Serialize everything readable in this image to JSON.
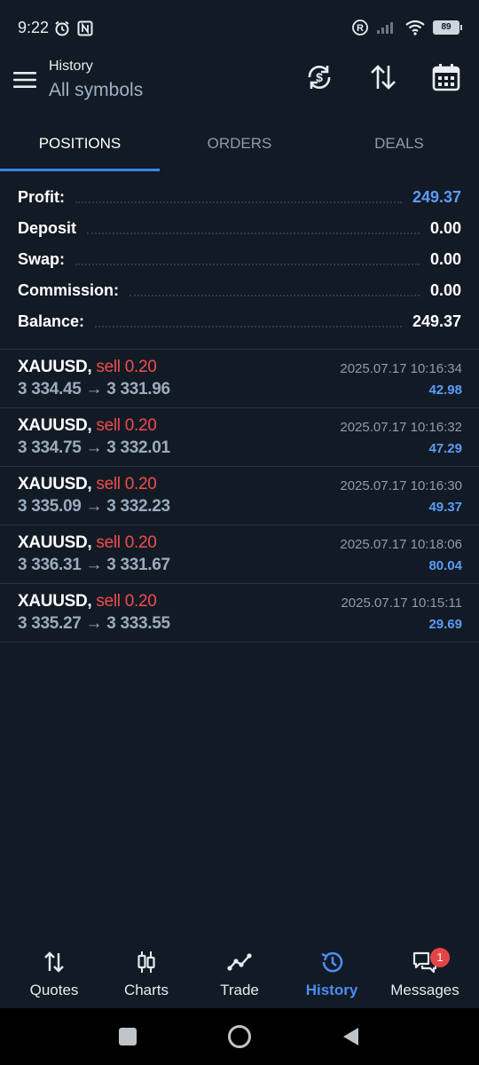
{
  "status": {
    "time": "9:22",
    "battery": "89"
  },
  "header": {
    "title_small": "History",
    "title_big": "All symbols",
    "icons": [
      "currency-exchange-icon",
      "sort-arrows-icon",
      "calendar-icon"
    ]
  },
  "tabs": [
    {
      "label": "POSITIONS",
      "active": true
    },
    {
      "label": "ORDERS",
      "active": false
    },
    {
      "label": "DEALS",
      "active": false
    }
  ],
  "summary": [
    {
      "label": "Profit:",
      "value": "249.37"
    },
    {
      "label": "Deposit",
      "value": "0.00"
    },
    {
      "label": "Swap:",
      "value": "0.00"
    },
    {
      "label": "Commission:",
      "value": "0.00"
    },
    {
      "label": "Balance:",
      "value": "249.37"
    }
  ],
  "deals": [
    {
      "symbol": "XAUUSD,",
      "side": "sell 0.20",
      "prices": "3 334.45 → 3 331.96",
      "time": "2025.07.17 10:16:34",
      "profit": "42.98"
    },
    {
      "symbol": "XAUUSD,",
      "side": "sell 0.20",
      "prices": "3 334.75 → 3 332.01",
      "time": "2025.07.17 10:16:32",
      "profit": "47.29"
    },
    {
      "symbol": "XAUUSD,",
      "side": "sell 0.20",
      "prices": "3 335.09 → 3 332.23",
      "time": "2025.07.17 10:16:30",
      "profit": "49.37"
    },
    {
      "symbol": "XAUUSD,",
      "side": "sell 0.20",
      "prices": "3 336.31 → 3 331.67",
      "time": "2025.07.17 10:18:06",
      "profit": "80.04"
    },
    {
      "symbol": "XAUUSD,",
      "side": "sell 0.20",
      "prices": "3 335.27 → 3 333.55",
      "time": "2025.07.17 10:15:11",
      "profit": "29.69"
    }
  ],
  "bottom_nav": [
    {
      "label": "Quotes",
      "icon": "quotes-arrows-icon"
    },
    {
      "label": "Charts",
      "icon": "candlestick-icon"
    },
    {
      "label": "Trade",
      "icon": "trend-line-icon"
    },
    {
      "label": "History",
      "icon": "history-clock-icon",
      "active": true
    },
    {
      "label": "Messages",
      "icon": "chat-bubbles-icon",
      "badge": "1"
    }
  ],
  "colors": {
    "background": "#121a25",
    "accent": "#3f82f0",
    "profit": "#5b9cf6",
    "sell": "#ef4d4d"
  }
}
